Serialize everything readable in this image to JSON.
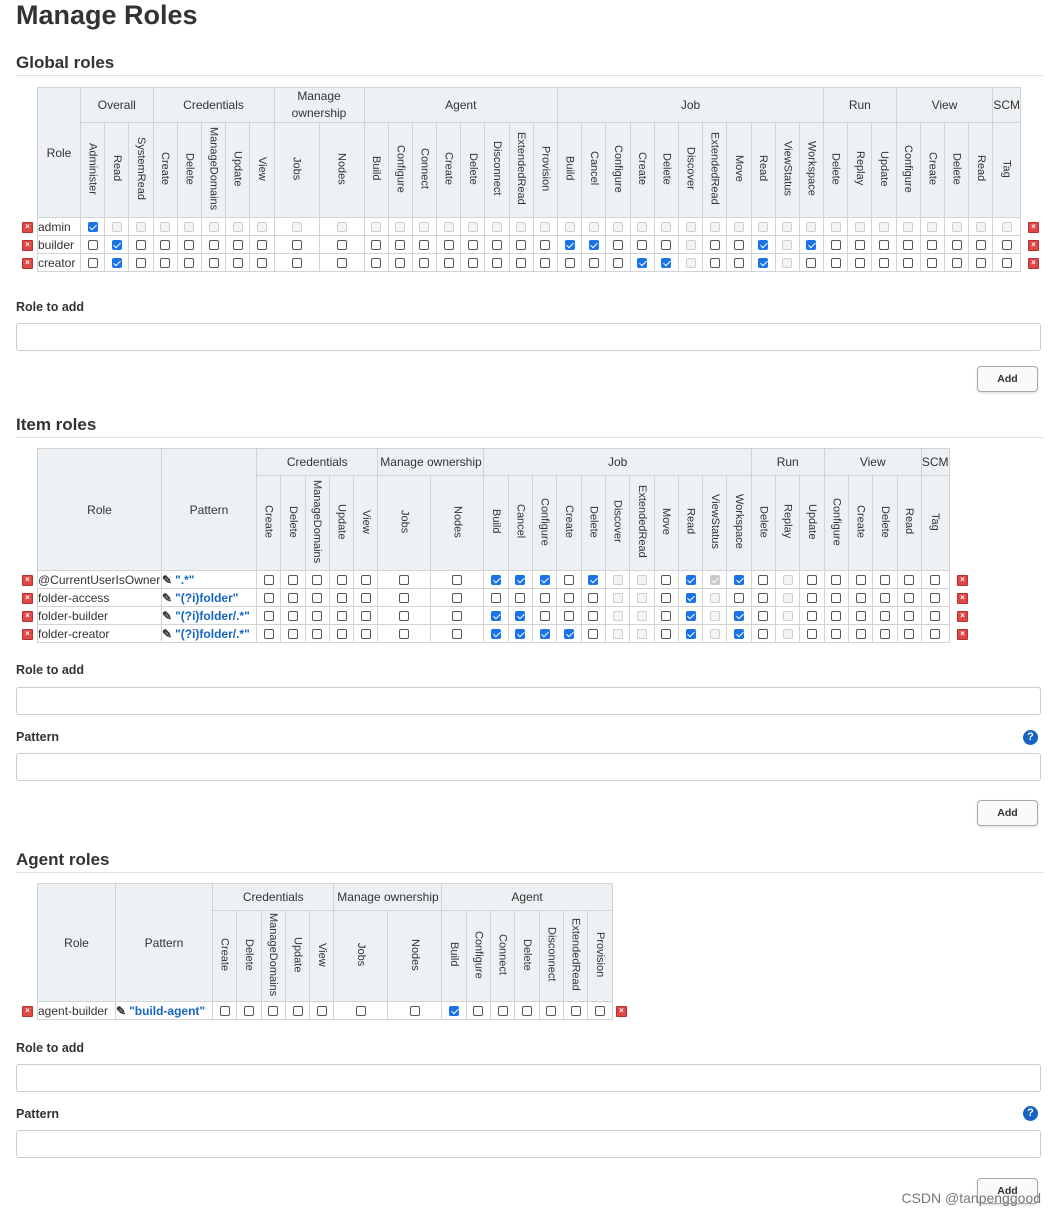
{
  "page_title": "Manage Roles",
  "global": {
    "title": "Global roles",
    "role_header": "Role",
    "groups": [
      {
        "label": "Overall",
        "perms": [
          "Administer",
          "Read",
          "SystemRead"
        ]
      },
      {
        "label": "Credentials",
        "perms": [
          "Create",
          "Delete",
          "ManageDomains",
          "Update",
          "View"
        ]
      },
      {
        "label": "Manage ownership",
        "perms": [
          "Jobs",
          "Nodes"
        ]
      },
      {
        "label": "Agent",
        "perms": [
          "Build",
          "Configure",
          "Connect",
          "Create",
          "Delete",
          "Disconnect",
          "ExtendedRead",
          "Provision"
        ]
      },
      {
        "label": "Job",
        "perms": [
          "Build",
          "Cancel",
          "Configure",
          "Create",
          "Delete",
          "Discover",
          "ExtendedRead",
          "Move",
          "Read",
          "ViewStatus",
          "Workspace"
        ]
      },
      {
        "label": "Run",
        "perms": [
          "Delete",
          "Replay",
          "Update"
        ]
      },
      {
        "label": "View",
        "perms": [
          "Configure",
          "Create",
          "Delete",
          "Read"
        ]
      },
      {
        "label": "SCM",
        "perms": [
          "Tag"
        ]
      }
    ],
    "rows": [
      {
        "name": "admin",
        "checked": [
          0
        ],
        "disabled": "allExceptFirst"
      },
      {
        "name": "builder",
        "checked": [
          1,
          18,
          19,
          26,
          28
        ],
        "disabled": [
          23,
          27
        ]
      },
      {
        "name": "creator",
        "checked": [
          1,
          21,
          22,
          26
        ],
        "disabled": [
          23,
          27
        ]
      }
    ],
    "role_to_add_label": "Role to add",
    "add_label": "Add"
  },
  "item": {
    "title": "Item roles",
    "role_header": "Role",
    "pattern_header": "Pattern",
    "groups": [
      {
        "label": "Credentials",
        "perms": [
          "Create",
          "Delete",
          "ManageDomains",
          "Update",
          "View"
        ]
      },
      {
        "label": "Manage ownership",
        "perms": [
          "Jobs",
          "Nodes"
        ]
      },
      {
        "label": "Job",
        "perms": [
          "Build",
          "Cancel",
          "Configure",
          "Create",
          "Delete",
          "Discover",
          "ExtendedRead",
          "Move",
          "Read",
          "ViewStatus",
          "Workspace"
        ]
      },
      {
        "label": "Run",
        "perms": [
          "Delete",
          "Replay",
          "Update"
        ]
      },
      {
        "label": "View",
        "perms": [
          "Configure",
          "Create",
          "Delete",
          "Read"
        ]
      },
      {
        "label": "SCM",
        "perms": [
          "Tag"
        ]
      }
    ],
    "rows": [
      {
        "name": "@CurrentUserIsOwner",
        "pattern": "\".*\"",
        "checked": [
          7,
          8,
          9,
          11,
          15,
          16,
          17
        ],
        "disabled": [
          12,
          13,
          16,
          19
        ]
      },
      {
        "name": "folder-access",
        "pattern": "\"(?i)folder\"",
        "checked": [
          15
        ],
        "disabled": [
          12,
          13,
          16,
          19
        ]
      },
      {
        "name": "folder-builder",
        "pattern": "\"(?i)folder/.*\"",
        "checked": [
          7,
          8,
          15,
          17
        ],
        "disabled": [
          12,
          13,
          16,
          19
        ]
      },
      {
        "name": "folder-creator",
        "pattern": "\"(?i)folder/.*\"",
        "checked": [
          7,
          8,
          9,
          10,
          15,
          17
        ],
        "disabled": [
          12,
          13,
          16,
          19
        ]
      }
    ],
    "role_to_add_label": "Role to add",
    "pattern_label": "Pattern",
    "add_label": "Add"
  },
  "agent": {
    "title": "Agent roles",
    "role_header": "Role",
    "pattern_header": "Pattern",
    "groups": [
      {
        "label": "Credentials",
        "perms": [
          "Create",
          "Delete",
          "ManageDomains",
          "Update",
          "View"
        ]
      },
      {
        "label": "Manage ownership",
        "perms": [
          "Jobs",
          "Nodes"
        ]
      },
      {
        "label": "Agent",
        "perms": [
          "Build",
          "Configure",
          "Connect",
          "Delete",
          "Disconnect",
          "ExtendedRead",
          "Provision"
        ]
      }
    ],
    "rows": [
      {
        "name": "agent-builder",
        "pattern": "\"build-agent\"",
        "checked": [
          7
        ],
        "disabled": []
      }
    ],
    "role_to_add_label": "Role to add",
    "pattern_label": "Pattern",
    "add_label": "Add"
  },
  "watermark": "CSDN @tanpenggood",
  "icons": {
    "help": "help-icon",
    "delete": "delete-role-icon",
    "edit": "edit-pattern-icon"
  },
  "colors": {
    "checked": "#1a73e8",
    "delete": "#e04848",
    "help": "#1565c0",
    "header_bg": "#eef1f3"
  }
}
